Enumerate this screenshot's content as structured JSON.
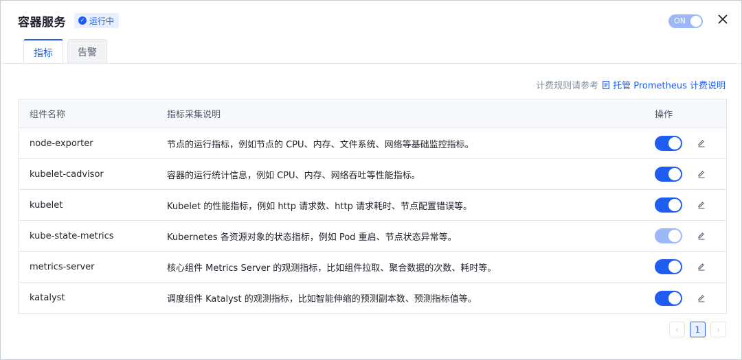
{
  "header": {
    "title": "容器服务",
    "status": "运行中",
    "toggle_label": "ON"
  },
  "tabs": [
    {
      "label": "指标",
      "active": true
    },
    {
      "label": "告警",
      "active": false
    }
  ],
  "billing": {
    "text": "计费规则请参考",
    "link": "托管 Prometheus 计费说明"
  },
  "table": {
    "columns": [
      "组件名称",
      "指标采集说明",
      "操作"
    ],
    "rows": [
      {
        "name": "node-exporter",
        "desc": "节点的运行指标，例如节点的 CPU、内存、文件系统、网络等基础监控指标。",
        "enabled": true
      },
      {
        "name": "kubelet-cadvisor",
        "desc": "容器的运行统计信息，例如 CPU、内存、网络吞吐等性能指标。",
        "enabled": true
      },
      {
        "name": "kubelet",
        "desc": "Kubelet 的性能指标，例如 http 请求数、http 请求耗时、节点配置错误等。",
        "enabled": true
      },
      {
        "name": "kube-state-metrics",
        "desc": "Kubernetes 各资源对象的状态指标，例如 Pod 重启、节点状态异常等。",
        "enabled": true,
        "disabled_control": true
      },
      {
        "name": "metrics-server",
        "desc": "核心组件 Metrics Server 的观测指标，比如组件拉取、聚合数据的次数、耗时等。",
        "enabled": true
      },
      {
        "name": "katalyst",
        "desc": "调度组件 Katalyst 的观测指标，比如智能伸缩的预测副本数、预测指标值等。",
        "enabled": true
      }
    ]
  },
  "pagination": {
    "current": "1",
    "prev": "‹",
    "next": "›"
  },
  "icons": {
    "status": "check-circle-icon",
    "close": "close-icon",
    "doc": "document-icon",
    "edit": "pencil-icon"
  },
  "colors": {
    "accent": "#1f5cf0",
    "accent_light": "#9cb8f8",
    "badge_bg": "#e8f0ff"
  }
}
